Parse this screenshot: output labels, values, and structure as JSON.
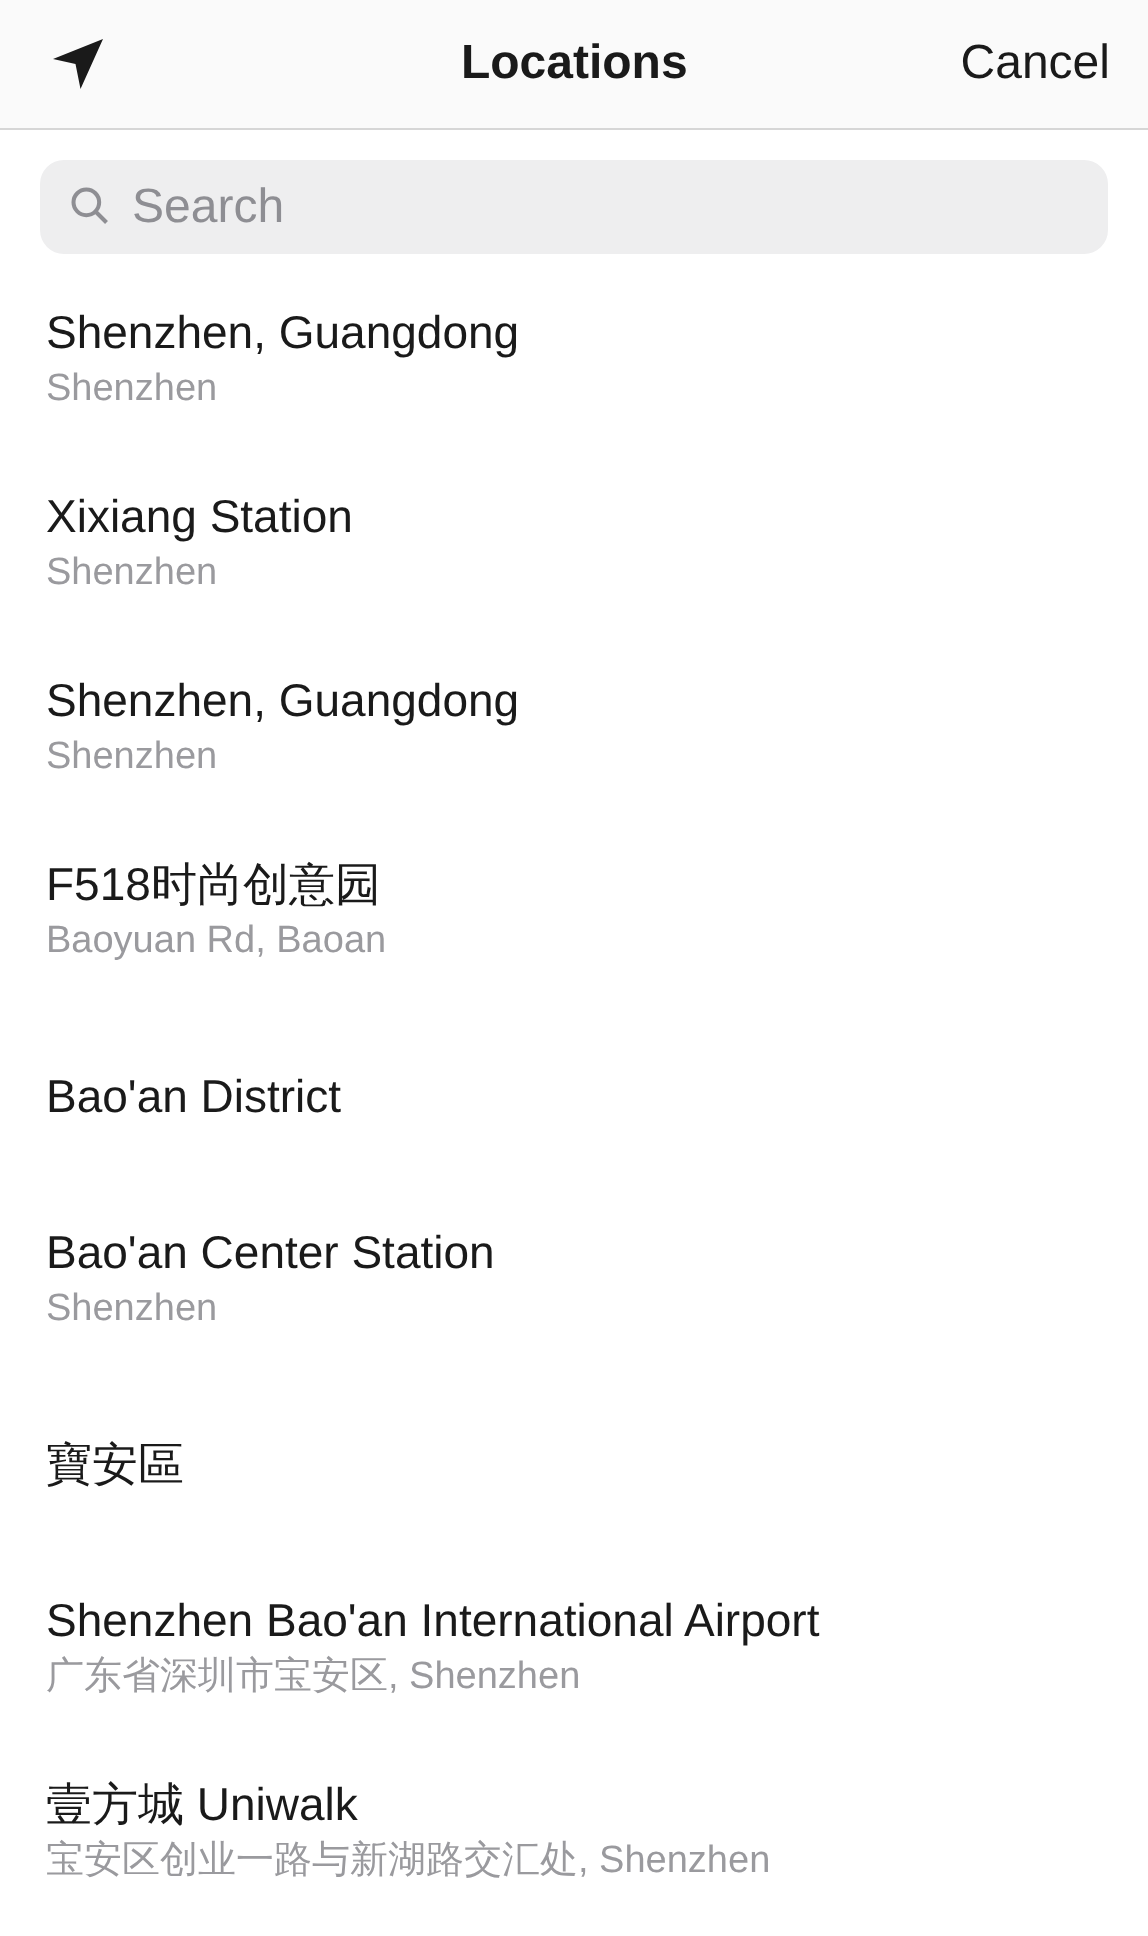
{
  "header": {
    "title": "Locations",
    "cancel": "Cancel"
  },
  "search": {
    "placeholder": "Search"
  },
  "locations": [
    {
      "name": "Shenzhen, Guangdong",
      "detail": "Shenzhen"
    },
    {
      "name": "Xixiang Station",
      "detail": "Shenzhen"
    },
    {
      "name": "Shenzhen, Guangdong",
      "detail": "Shenzhen"
    },
    {
      "name": "F518时尚创意园",
      "detail": "Baoyuan Rd, Baoan"
    },
    {
      "name": "Bao'an District"
    },
    {
      "name": "Bao'an Center Station",
      "detail": "Shenzhen"
    },
    {
      "name": "寶安區"
    },
    {
      "name": "Shenzhen Bao'an International Airport",
      "detail": "广东省深圳市宝安区, Shenzhen"
    },
    {
      "name": "壹方城 Uniwalk",
      "detail": "宝安区创业一路与新湖路交汇处, Shenzhen"
    }
  ]
}
